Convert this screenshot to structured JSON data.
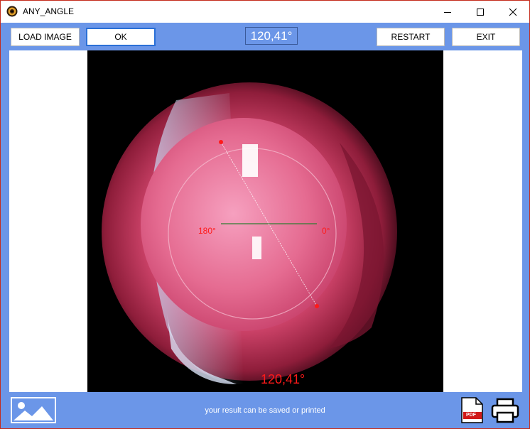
{
  "window": {
    "title": "ANY_ANGLE",
    "controls": [
      "minimize",
      "maximize",
      "close"
    ]
  },
  "toolbar": {
    "load_image_label": "LOAD IMAGE",
    "ok_label": "OK",
    "angle_value": "120,41°",
    "restart_label": "RESTART",
    "exit_label": "EXIT"
  },
  "image": {
    "label_180": "180°",
    "label_0": "0°",
    "result_label": "120,41°"
  },
  "bottom": {
    "status_text": "your result can be saved or printed",
    "pdf_badge": "PDF"
  },
  "colors": {
    "accent": "#6b96e8",
    "marker": "#ff1a1a",
    "reference_line": "#2e7d32"
  }
}
